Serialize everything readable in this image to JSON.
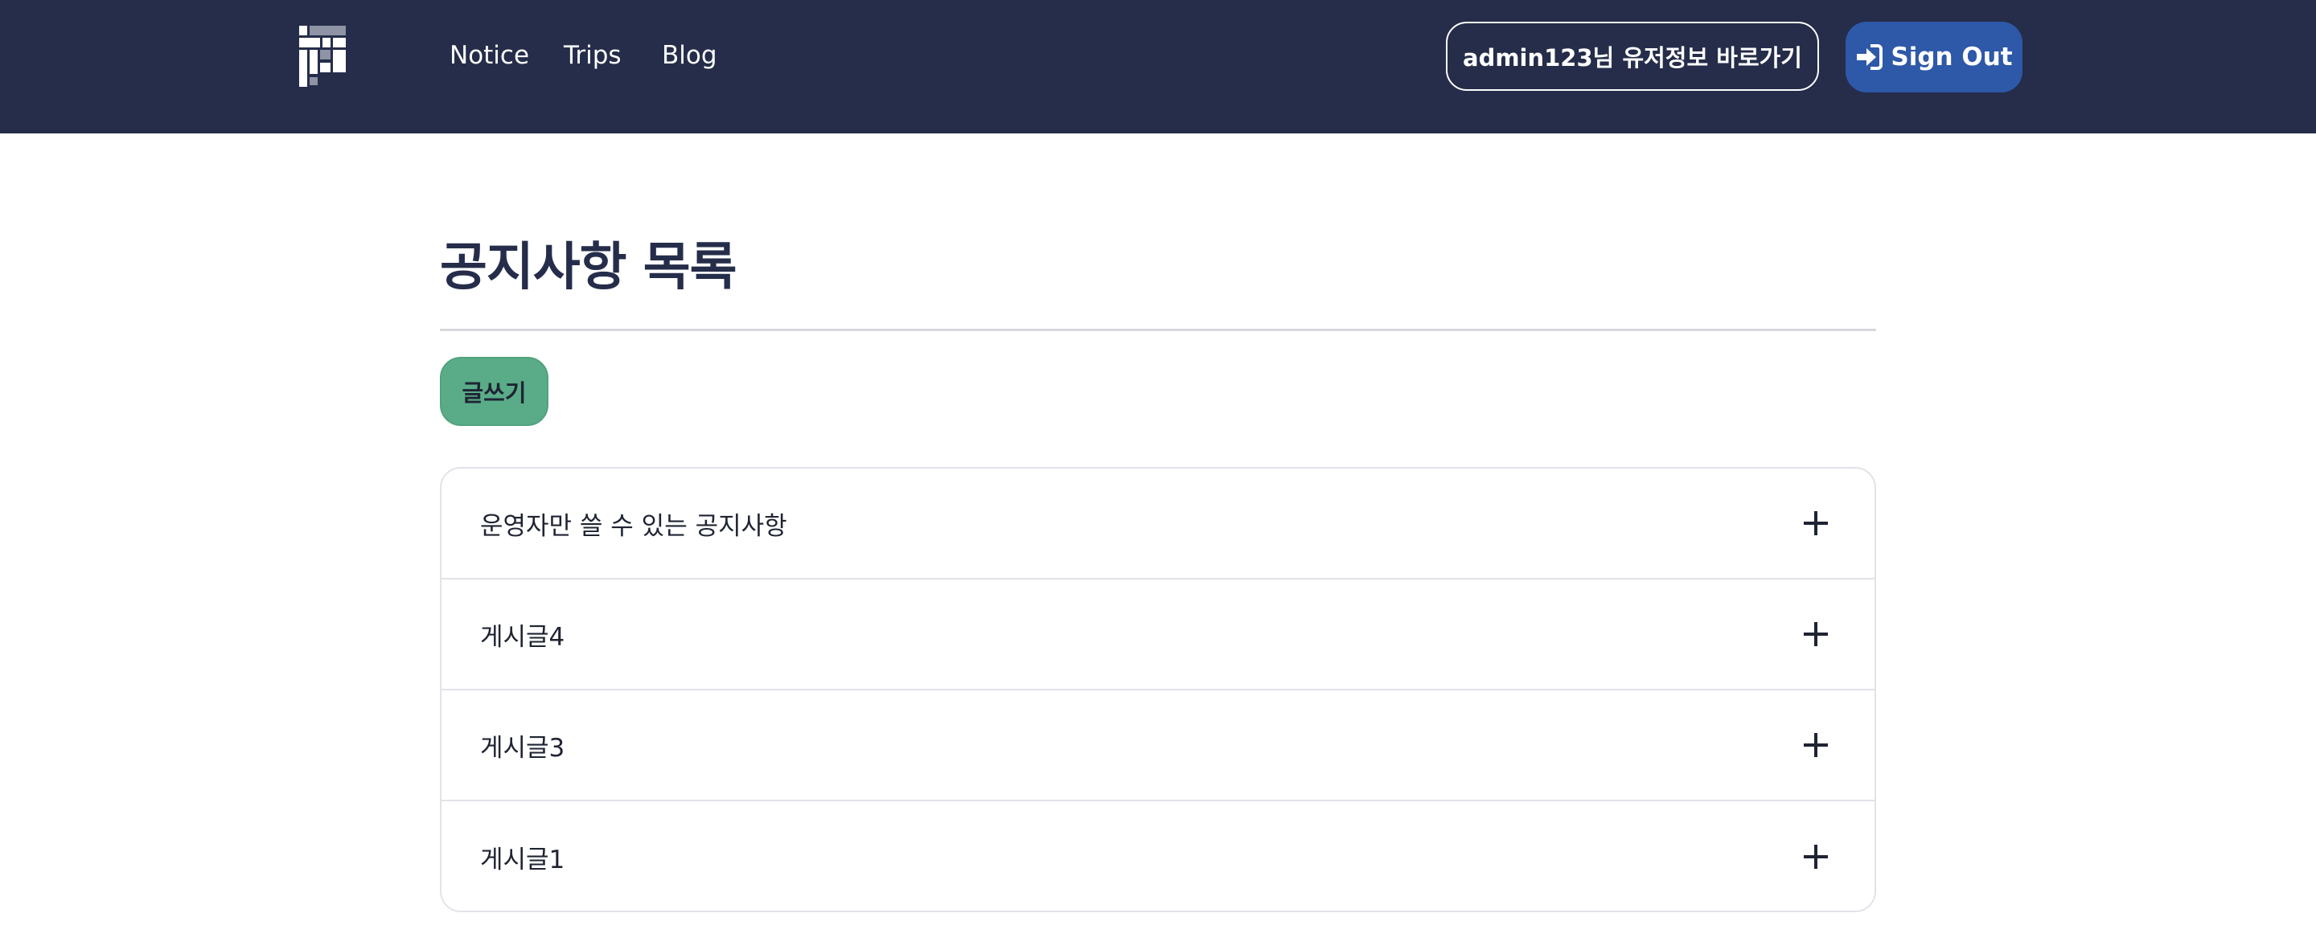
{
  "navbar": {
    "links": [
      {
        "label": "Notice"
      },
      {
        "label": "Trips"
      },
      {
        "label": "Blog"
      }
    ],
    "user_button_label": "admin123님 유저정보 바로가기",
    "signout_label": "Sign Out",
    "signout_icon": "sign-in-icon",
    "logo_icon": "brand-logo-icon"
  },
  "main": {
    "title": "공지사항 목록",
    "write_button_label": "글쓰기",
    "items": [
      {
        "label": "운영자만 쓸 수 있는 공지사항"
      },
      {
        "label": "게시글4"
      },
      {
        "label": "게시글3"
      },
      {
        "label": "게시글1"
      }
    ],
    "expand_icon": "plus-icon"
  },
  "colors": {
    "navbar_bg": "#252d4a",
    "signout_bg": "#2e58a8",
    "write_button_bg": "#5aac88",
    "title_text": "#252d4a"
  }
}
